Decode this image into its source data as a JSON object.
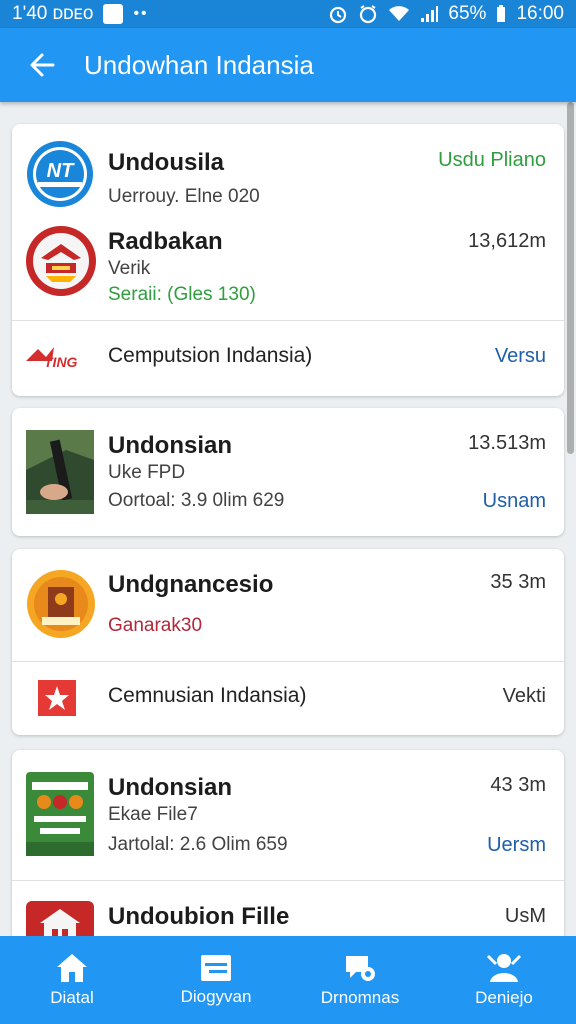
{
  "status_bar": {
    "time_left": "1'40 ᴅᴅᴇᴏ",
    "battery": "65%",
    "time_right": "16:00"
  },
  "app_bar": {
    "title": "Undowhan Indansia"
  },
  "cards": [
    {
      "rows": [
        {
          "name": "Undousila",
          "line1": "Uerrouy. Elne 020",
          "right": "Usdu Pliano",
          "right_color": "#2e9e3e",
          "icon": "nt-logo-icon"
        },
        {
          "name": "Radbakan",
          "line1": "Verik",
          "line2": "Seraii: (Gles 130)",
          "right": "13,612m",
          "icon": "garuda-badge-icon"
        }
      ],
      "footer": {
        "text": "Cemputsion Indansia)",
        "right": "Versu",
        "icon": "red-brand-logo-icon"
      }
    },
    {
      "rows": [
        {
          "name": "Undonsian",
          "line1": "Uke FPD",
          "line2": "Oortoal: 3.9 0lim 629",
          "right": "13.513m",
          "right2": "Usnam",
          "icon": "photo-thumbnail-icon"
        }
      ]
    },
    {
      "rows": [
        {
          "name": "Undgnancesio",
          "line1": "Ganarak30",
          "right": "35 3m",
          "icon": "orange-emblem-icon"
        }
      ],
      "footer": {
        "text": "Cemnusian Indansia)",
        "right": "Vekti",
        "icon": "red-star-flag-icon"
      }
    },
    {
      "rows": [
        {
          "name": "Undonsian",
          "line1": "Ekae File7",
          "line2": "Jartolal: 2.6 Olim 659",
          "right": "43 3m",
          "right2": "Uersm",
          "icon": "green-poster-icon"
        },
        {
          "name": "Undoubion Fille",
          "right": "UsM",
          "icon": "red-building-icon"
        }
      ]
    }
  ],
  "bottom_nav": [
    {
      "label": "Diatal",
      "icon": "home-icon"
    },
    {
      "label": "Diogyvan",
      "icon": "card-icon"
    },
    {
      "label": "Drnomnas",
      "icon": "chat-icon"
    },
    {
      "label": "Deniejo",
      "icon": "person-badge-icon"
    }
  ]
}
